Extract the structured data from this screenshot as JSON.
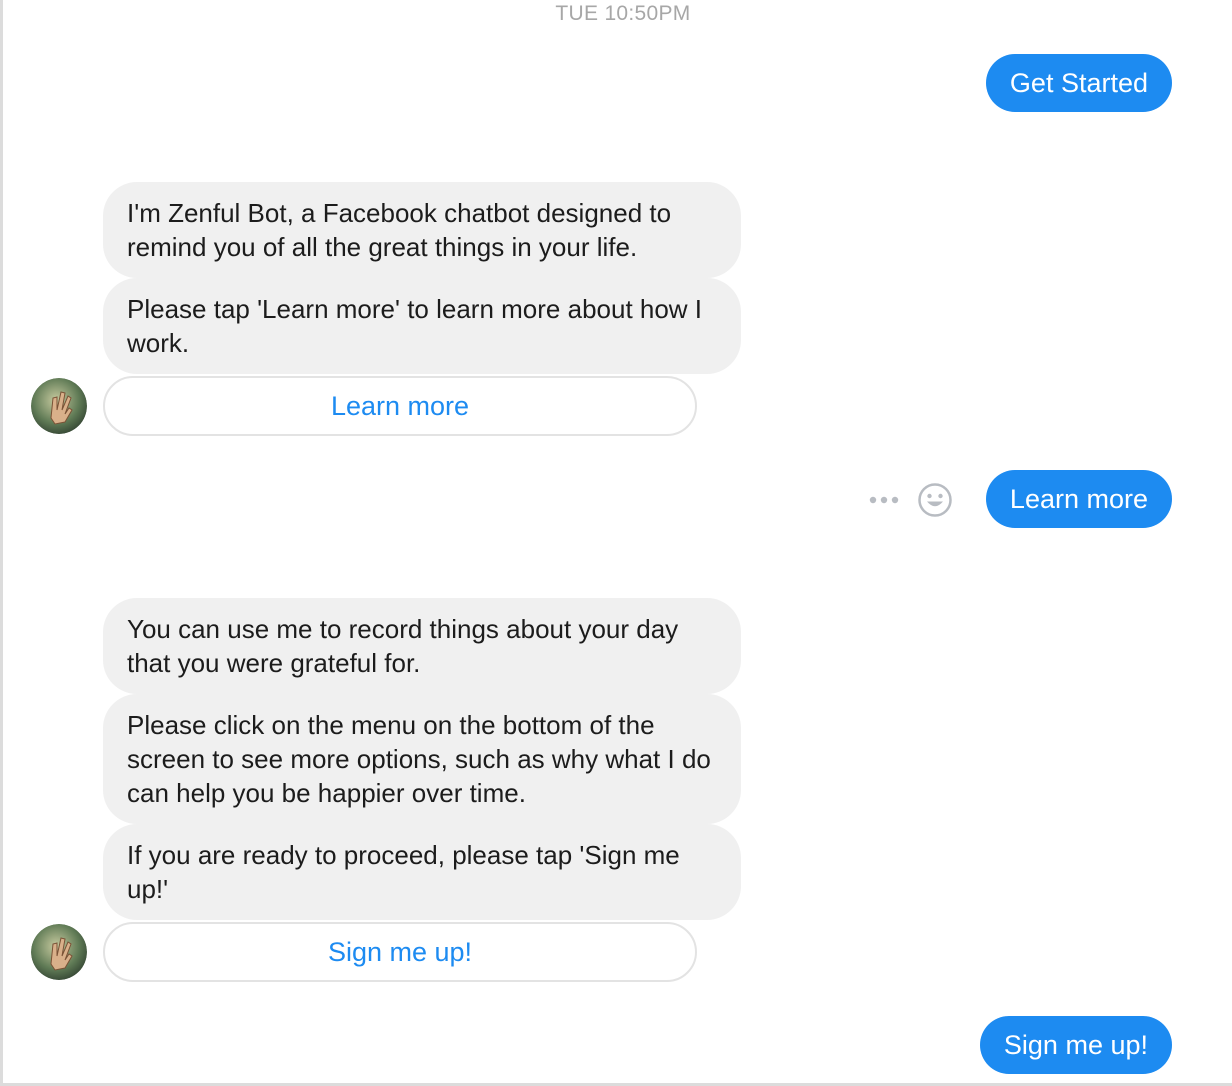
{
  "conversation": {
    "timestamp": "TUE 10:50PM",
    "messages": [
      {
        "sender": "user",
        "text": "Get Started"
      },
      {
        "sender": "bot",
        "text": "I'm Zenful Bot, a Facebook chatbot designed to remind you of all the great things in your life."
      },
      {
        "sender": "bot",
        "text": "Please tap 'Learn more' to learn more about how I work."
      },
      {
        "sender": "bot-button",
        "text": "Learn more"
      },
      {
        "sender": "user",
        "text": "Learn more"
      },
      {
        "sender": "bot",
        "text": "You can use me to record things about your day that you were grateful for."
      },
      {
        "sender": "bot",
        "text": "Please click on the menu on the bottom of the screen to see more options, such as why what I do can help you be happier over time."
      },
      {
        "sender": "bot",
        "text": "If you are ready to proceed, please tap 'Sign me up!'"
      },
      {
        "sender": "bot-button",
        "text": "Sign me up!"
      },
      {
        "sender": "user",
        "text": "Sign me up!"
      }
    ]
  },
  "hover_actions": {
    "icons": [
      "more-options-icon",
      "emoji-reaction-icon"
    ]
  },
  "colors": {
    "user_bubble": "#1d8bf1",
    "bot_bubble": "#f0f0f0",
    "button_text": "#1d8bf1",
    "timestamp": "#a7a7a7"
  }
}
